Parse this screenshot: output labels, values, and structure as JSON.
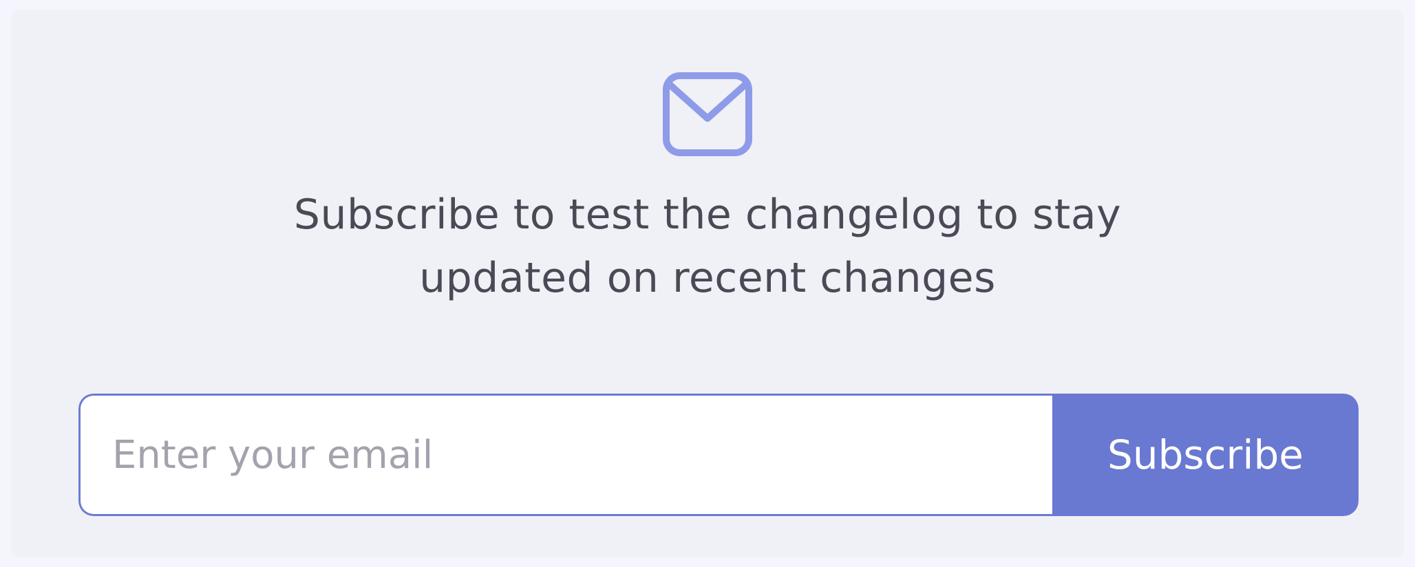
{
  "newsletter": {
    "icon": "mail-icon",
    "message": "Subscribe to test the changelog to stay updated on recent changes",
    "email_placeholder": "Enter your email",
    "email_value": "",
    "subscribe_label": "Subscribe"
  },
  "colors": {
    "accent": "#6978d1",
    "icon": "#8e9be8",
    "card_background": "#f0f0f7",
    "text": "#4a4955",
    "placeholder": "#a3a2ad"
  }
}
